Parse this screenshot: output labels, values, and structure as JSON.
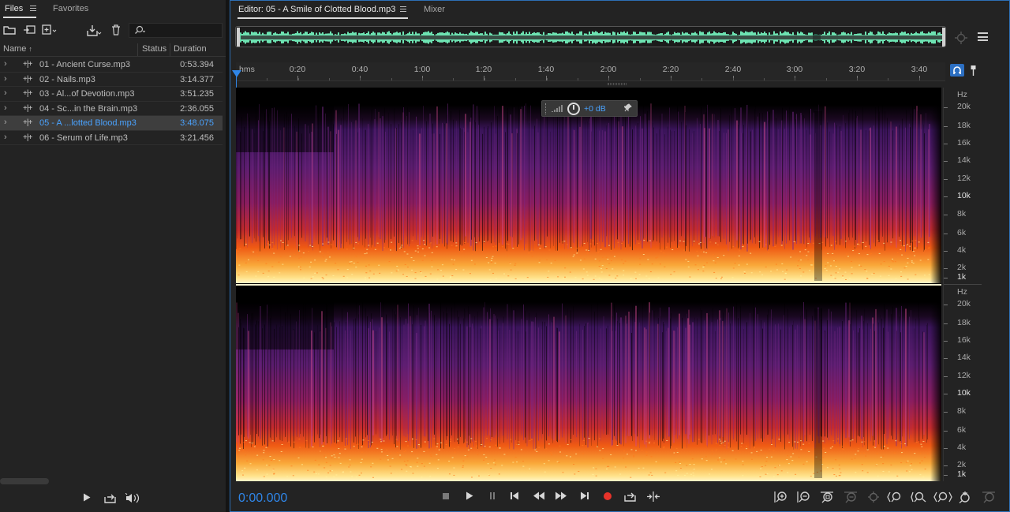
{
  "files_panel": {
    "tabs": [
      {
        "label": "Files"
      },
      {
        "label": "Favorites"
      }
    ],
    "toolbar_icons": [
      "open-folder-icon",
      "import-icon",
      "new-file-icon",
      "insert-icon",
      "delete-icon"
    ],
    "search": {
      "value": "",
      "placeholder": ""
    },
    "columns": {
      "name": "Name",
      "sort_indicator": "↑",
      "status": "Status",
      "duration": "Duration"
    },
    "files": [
      {
        "name": "01 - Ancient Curse.mp3",
        "duration": "0:53.394",
        "selected": false
      },
      {
        "name": "02 - Nails.mp3",
        "duration": "3:14.377",
        "selected": false
      },
      {
        "name": "03 - Al...of Devotion.mp3",
        "duration": "3:51.235",
        "selected": false
      },
      {
        "name": "04 - Sc...in the Brain.mp3",
        "duration": "2:36.055",
        "selected": false
      },
      {
        "name": "05 - A ...lotted Blood.mp3",
        "duration": "3:48.075",
        "selected": true
      },
      {
        "name": "06 - Serum of Life.mp3",
        "duration": "3:21.456",
        "selected": false
      }
    ],
    "bottom_icons": [
      "play-icon",
      "loop-icon",
      "volume-icon"
    ]
  },
  "editor": {
    "tabs": [
      {
        "label": "Editor: 05 - A Smile of Clotted Blood.mp3"
      },
      {
        "label": "Mixer"
      }
    ],
    "ruler_labels": [
      "hms",
      "0:20",
      "0:40",
      "1:00",
      "1:20",
      "1:40",
      "2:00",
      "2:20",
      "2:40",
      "3:00",
      "3:20",
      "3:40"
    ],
    "hud": {
      "gain": "+0 dB"
    },
    "freq_unit": "Hz",
    "freq_labels": [
      "20k",
      "18k",
      "16k",
      "14k",
      "12k",
      "10k",
      "8k",
      "6k",
      "4k",
      "2k",
      "1k"
    ],
    "timecode": "0:00.000",
    "transport_icons": [
      "stop-icon",
      "play-icon",
      "pause-icon",
      "go-to-start-icon",
      "rewind-icon",
      "fast-forward-icon",
      "go-to-end-icon",
      "record-icon",
      "loop-playback-icon",
      "skip-selection-icon"
    ],
    "zoom_icons": [
      "zoom-in-amplitude-icon",
      "zoom-out-amplitude-icon",
      "zoom-to-selection-icon",
      "zoom-out-full-icon",
      "zoom-in-at-playhead-icon",
      "zoom-in-time-left-icon",
      "zoom-in-time-icon",
      "zoom-out-time-icon",
      "zoom-reset-icon",
      "zoom-disabled-icon"
    ],
    "colors": {
      "accent": "#2f86e8",
      "waveform": "#6de3b2",
      "spectrum_hot": "#fff3a0",
      "spectrum_mid": "#e83a1c",
      "spectrum_low": "#4a1a6e"
    }
  }
}
